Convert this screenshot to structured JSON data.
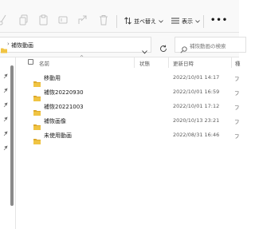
{
  "toolbar": {
    "icons": [
      "cut-icon",
      "copy-icon",
      "paste-icon",
      "rename-icon",
      "share-icon",
      "delete-icon"
    ],
    "sort_label": "並べ替え",
    "view_label": "表示",
    "more_label": "•••"
  },
  "address": {
    "path_label": "補恢動画",
    "search_placeholder": "補恢動画の検索"
  },
  "columns": {
    "name": "名前",
    "status": "状態",
    "date": "更新日時",
    "type": "種"
  },
  "files": [
    {
      "name": "移動用",
      "date": "2022/10/01 14:17",
      "type": "フ"
    },
    {
      "name": "補恢20220930",
      "date": "2022/10/01 16:59",
      "type": "フ"
    },
    {
      "name": "補恢20221003",
      "date": "2022/10/01 17:12",
      "type": "フ"
    },
    {
      "name": "補恢画像",
      "date": "2020/10/13 23:21",
      "type": "フ"
    },
    {
      "name": "未使用動画",
      "date": "2022/08/31 16:46",
      "type": "フ"
    }
  ],
  "colors": {
    "folder": "#f0c443",
    "folder_dark": "#dba527",
    "accent": "#005fb8"
  }
}
